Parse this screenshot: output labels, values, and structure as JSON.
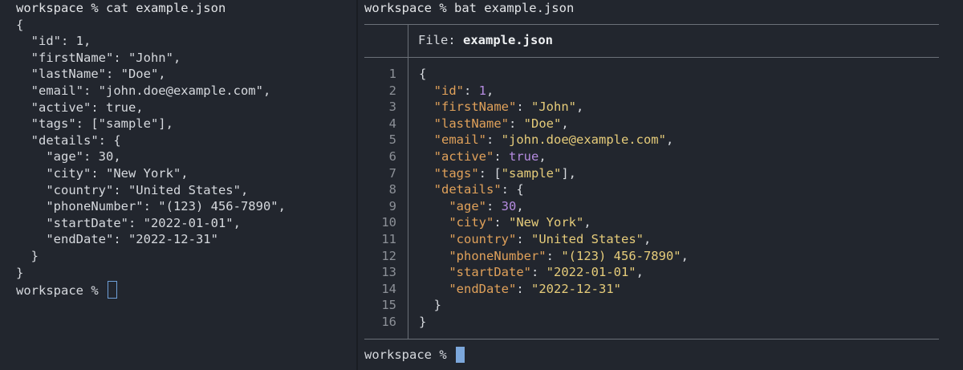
{
  "left_pane": {
    "command_line": "workspace % cat example.json",
    "lines": [
      "{",
      "  \"id\": 1,",
      "  \"firstName\": \"John\",",
      "  \"lastName\": \"Doe\",",
      "  \"email\": \"john.doe@example.com\",",
      "  \"active\": true,",
      "  \"tags\": [\"sample\"],",
      "  \"details\": {",
      "    \"age\": 30,",
      "    \"city\": \"New York\",",
      "    \"country\": \"United States\",",
      "    \"phoneNumber\": \"(123) 456-7890\",",
      "    \"startDate\": \"2022-01-01\",",
      "    \"endDate\": \"2022-12-31\"",
      "  }",
      "}"
    ],
    "prompt": "workspace % "
  },
  "right_pane": {
    "command_line": "workspace % bat example.json",
    "file_label": "File: ",
    "file_name": "example.json",
    "line_numbers": [
      "1",
      "2",
      "3",
      "4",
      "5",
      "6",
      "7",
      "8",
      "9",
      "10",
      "11",
      "12",
      "13",
      "14",
      "15",
      "16"
    ],
    "code": {
      "l1": "{",
      "l2_key": "\"id\"",
      "l2_val": "1",
      "l3_key": "\"firstName\"",
      "l3_val": "\"John\"",
      "l4_key": "\"lastName\"",
      "l4_val": "\"Doe\"",
      "l5_key": "\"email\"",
      "l5_val": "\"john.doe@example.com\"",
      "l6_key": "\"active\"",
      "l6_val": "true",
      "l7_key": "\"tags\"",
      "l7_val": "\"sample\"",
      "l8_key": "\"details\"",
      "l9_key": "\"age\"",
      "l9_val": "30",
      "l10_key": "\"city\"",
      "l10_val": "\"New York\"",
      "l11_key": "\"country\"",
      "l11_val": "\"United States\"",
      "l12_key": "\"phoneNumber\"",
      "l12_val": "\"(123) 456-7890\"",
      "l13_key": "\"startDate\"",
      "l13_val": "\"2022-01-01\"",
      "l14_key": "\"endDate\"",
      "l14_val": "\"2022-12-31\"",
      "l15": "}",
      "l16": "}"
    },
    "prompt": "workspace % "
  },
  "colors": {
    "background": "#22262e",
    "key": "#e0a15a",
    "string": "#e6cc7a",
    "number_bool": "#b58be0",
    "cursor": "#7ca7db"
  }
}
